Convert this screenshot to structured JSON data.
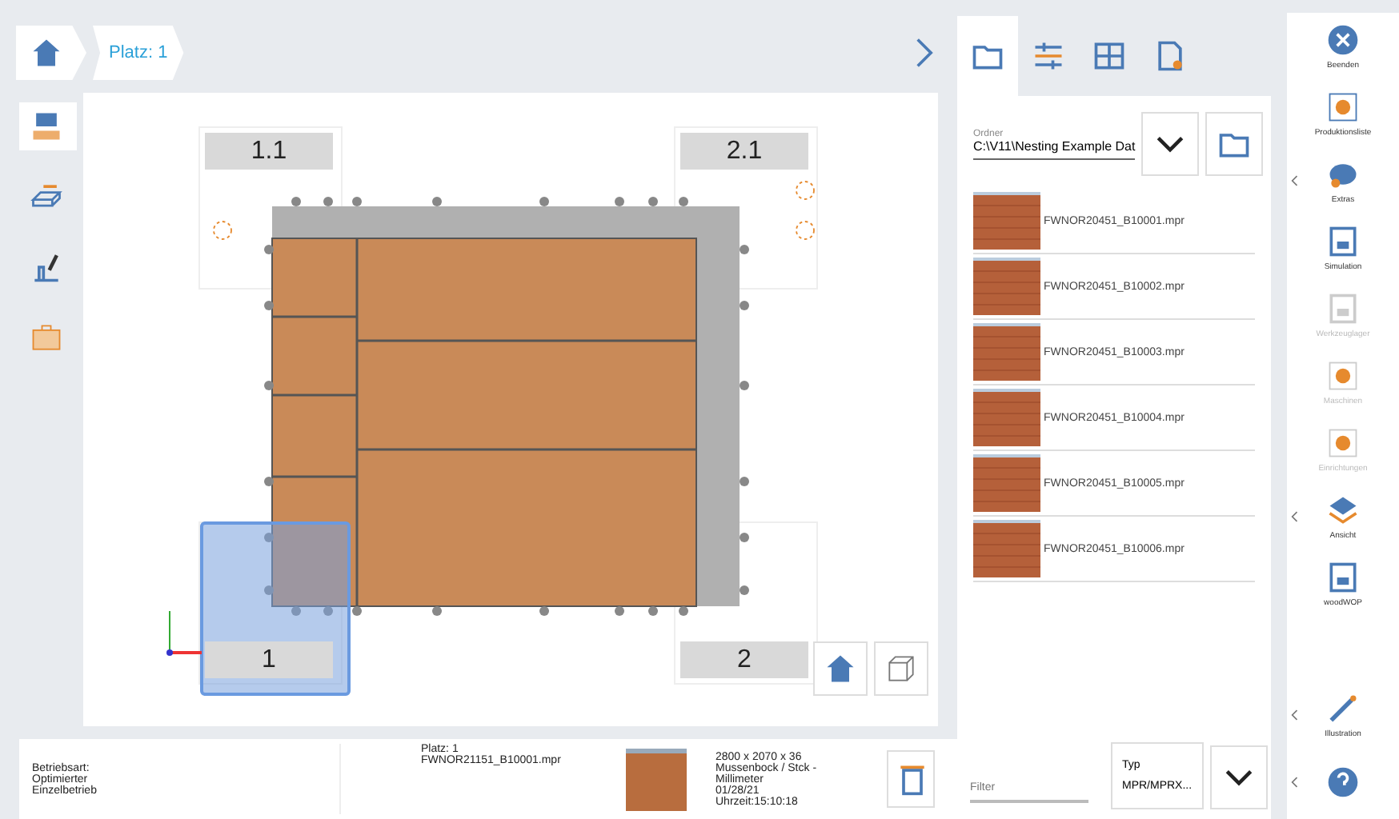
{
  "breadcrumb": [
    {
      "kind": "home"
    },
    {
      "kind": "text",
      "label": "Platz: 1"
    }
  ],
  "canvas": {
    "labels": [
      {
        "text": "1.1",
        "selected": false
      },
      {
        "text": "2.1",
        "selected": false
      },
      {
        "text": "1",
        "selected": true
      },
      {
        "text": "2",
        "selected": false
      }
    ]
  },
  "left_tools": [
    {
      "selected": true
    },
    {
      "selected": false
    },
    {
      "selected": false
    },
    {
      "selected": false
    }
  ],
  "status": {
    "mode": [
      "Betriebsart:",
      "Optimierter",
      "Einzelbetrieb"
    ],
    "place": [
      "Platz: 1",
      "FWNOR21151_B10001.mpr"
    ],
    "info": [
      "2800 x 2070 x 36",
      "Mussenbock / Stck -",
      "Millimeter",
      "01/28/21",
      "Uhrzeit:15:10:18"
    ]
  },
  "file_panel": {
    "tabs": [
      {
        "selected": true
      },
      {
        "selected": false
      },
      {
        "selected": false
      },
      {
        "selected": false
      }
    ],
    "folder_label": "Ordner",
    "folder_value": "C:\\V11\\Nesting Example Dat",
    "files": [
      "FWNOR20451_B10001.mpr",
      "FWNOR20451_B10002.mpr",
      "FWNOR20451_B10003.mpr",
      "FWNOR20451_B10004.mpr",
      "FWNOR20451_B10005.mpr",
      "FWNOR20451_B10006.mpr"
    ],
    "filter_placeholder": "Filter",
    "type_label": "Typ",
    "type_value": "MPR/MPRX..."
  },
  "rail": [
    {
      "label": "Beenden",
      "chevron": false,
      "disabled": false
    },
    {
      "label": "Produktionsliste",
      "chevron": false,
      "disabled": false
    },
    {
      "label": "Extras",
      "chevron": true,
      "disabled": false
    },
    {
      "label": "Simulation",
      "chevron": false,
      "disabled": false
    },
    {
      "label": "Werkzeuglager",
      "chevron": false,
      "disabled": true
    },
    {
      "label": "Maschinen",
      "chevron": false,
      "disabled": true
    },
    {
      "label": "Einrichtungen",
      "chevron": false,
      "disabled": true
    },
    {
      "label": "Ansicht",
      "chevron": true,
      "disabled": false
    },
    {
      "label": "woodWOP",
      "chevron": false,
      "disabled": false
    },
    {
      "label": "Illustration",
      "chevron": true,
      "disabled": false
    },
    {
      "chevron": true,
      "disabled": false
    }
  ]
}
